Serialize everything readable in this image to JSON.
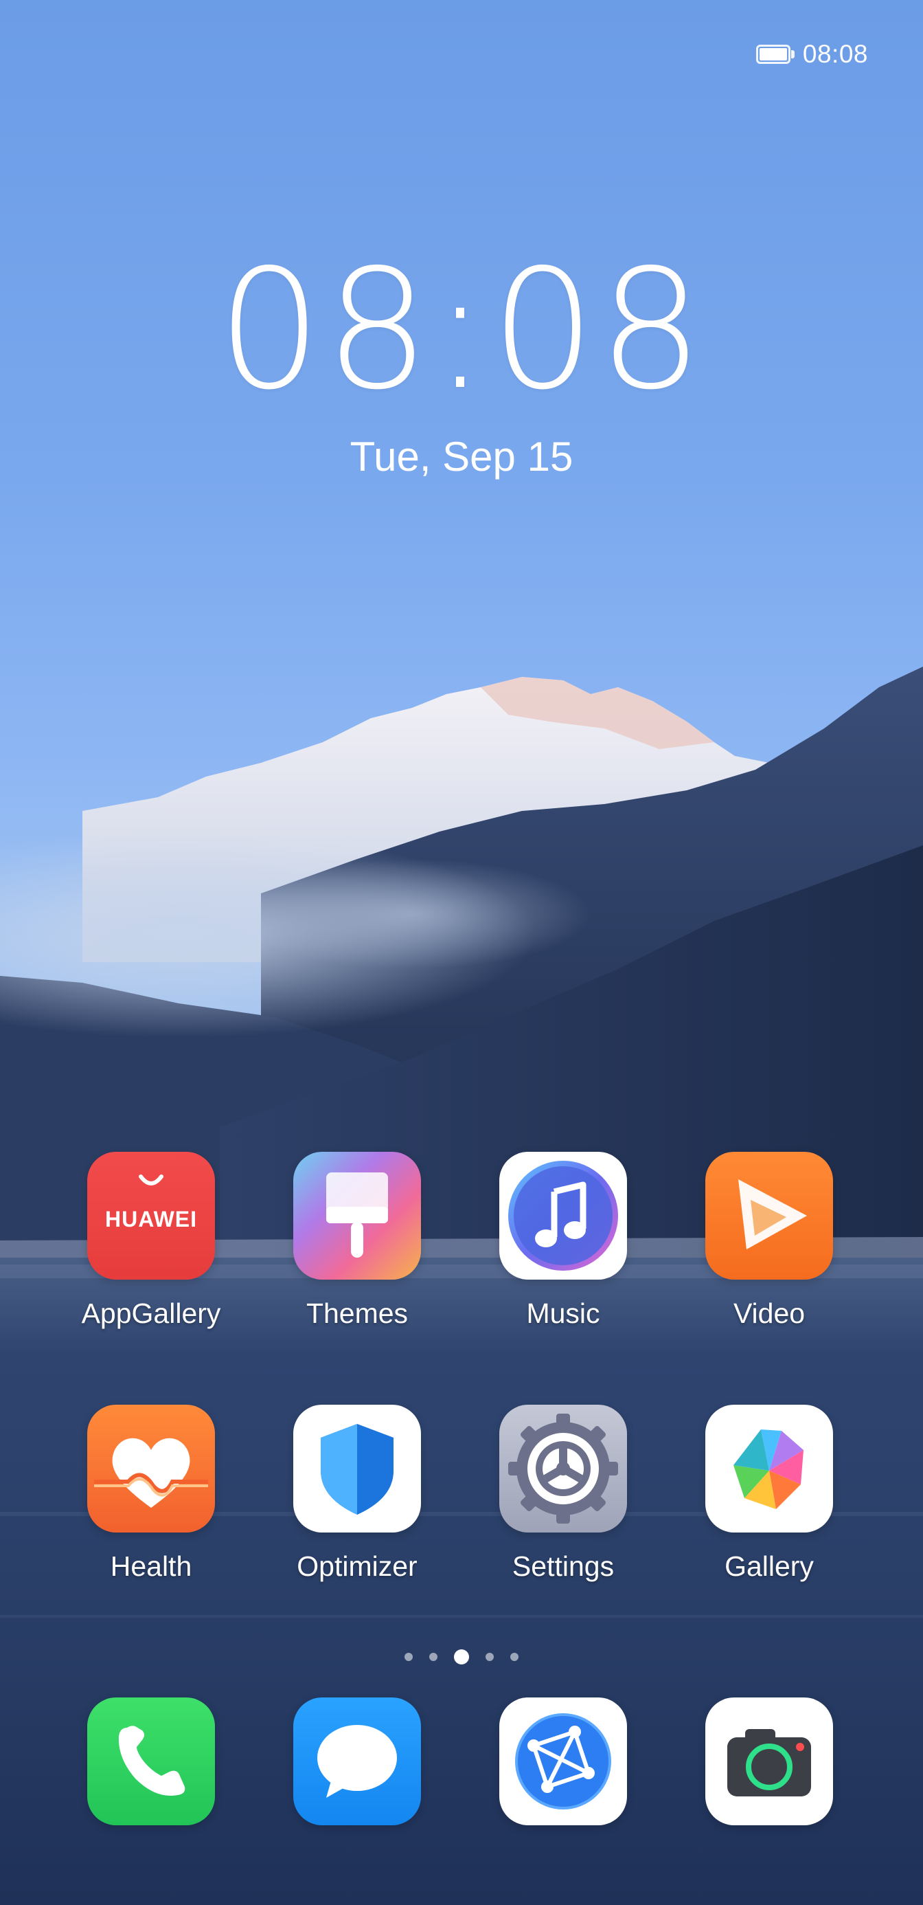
{
  "status_bar": {
    "time": "08:08",
    "battery_icon": "battery-icon"
  },
  "lock_clock": {
    "time": "08:08",
    "date": "Tue, Sep 15"
  },
  "apps_row1": [
    {
      "label": "AppGallery",
      "icon": "appgallery-icon",
      "icon_text": "HUAWEI"
    },
    {
      "label": "Themes",
      "icon": "themes-brush-icon"
    },
    {
      "label": "Music",
      "icon": "music-note-icon"
    },
    {
      "label": "Video",
      "icon": "video-play-icon"
    }
  ],
  "apps_row2": [
    {
      "label": "Health",
      "icon": "health-heart-icon"
    },
    {
      "label": "Optimizer",
      "icon": "optimizer-shield-icon"
    },
    {
      "label": "Settings",
      "icon": "settings-gear-icon"
    },
    {
      "label": "Gallery",
      "icon": "gallery-petals-icon"
    }
  ],
  "page_indicator": {
    "pages": 5,
    "current": 3
  },
  "dock": [
    {
      "icon": "phone-icon"
    },
    {
      "icon": "messages-icon"
    },
    {
      "icon": "browser-icon"
    },
    {
      "icon": "camera-icon"
    }
  ]
}
